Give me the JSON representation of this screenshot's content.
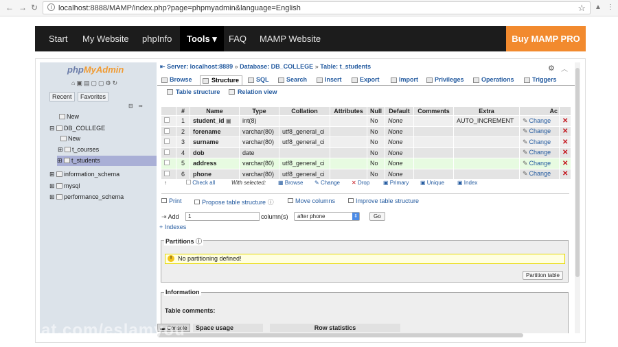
{
  "browser": {
    "url": "localhost:8888/MAMP/index.php?page=phpmyadmin&language=English"
  },
  "mamp_nav": {
    "items": [
      "Start",
      "My Website",
      "phpInfo",
      "Tools ▾",
      "FAQ",
      "MAMP Website"
    ],
    "active": "Tools ▾",
    "buy": "Buy MAMP PRO",
    "accent_color": "#f28a2e"
  },
  "pma": {
    "logo_a": "php",
    "logo_b": "MyAdmin",
    "nav_tabs": [
      "Recent",
      "Favorites"
    ],
    "tree": [
      {
        "label": "New",
        "level": 1
      },
      {
        "label": "DB_COLLEGE",
        "level": 0
      },
      {
        "label": "New",
        "level": 2
      },
      {
        "label": "t_courses",
        "level": 2
      },
      {
        "label": "t_students",
        "level": 2,
        "selected": true
      },
      {
        "label": "information_schema",
        "level": 0
      },
      {
        "label": "mysql",
        "level": 0
      },
      {
        "label": "performance_schema",
        "level": 0
      }
    ]
  },
  "breadcrumb": {
    "server": "Server: localhost:8889",
    "database": "Database: DB_COLLEGE",
    "table": "Table: t_students",
    "sep": "»"
  },
  "tabs": [
    "Browse",
    "Structure",
    "SQL",
    "Search",
    "Insert",
    "Export",
    "Import",
    "Privileges",
    "Operations",
    "Triggers"
  ],
  "active_tab": "Structure",
  "subtabs": [
    "Table structure",
    "Relation view"
  ],
  "columns": {
    "headers": [
      "",
      "#",
      "Name",
      "Type",
      "Collation",
      "Attributes",
      "Null",
      "Default",
      "Comments",
      "Extra",
      "Ac"
    ],
    "rows": [
      {
        "num": "1",
        "name": "student_id",
        "type": "int(8)",
        "collation": "",
        "attributes": "",
        "null": "No",
        "default": "None",
        "comments": "",
        "extra": "AUTO_INCREMENT"
      },
      {
        "num": "2",
        "name": "forename",
        "type": "varchar(80)",
        "collation": "utf8_general_ci",
        "attributes": "",
        "null": "No",
        "default": "None",
        "comments": "",
        "extra": ""
      },
      {
        "num": "3",
        "name": "surname",
        "type": "varchar(80)",
        "collation": "utf8_general_ci",
        "attributes": "",
        "null": "No",
        "default": "None",
        "comments": "",
        "extra": ""
      },
      {
        "num": "4",
        "name": "dob",
        "type": "date",
        "collation": "",
        "attributes": "",
        "null": "No",
        "default": "None",
        "comments": "",
        "extra": ""
      },
      {
        "num": "5",
        "name": "address",
        "type": "varchar(80)",
        "collation": "utf8_general_ci",
        "attributes": "",
        "null": "No",
        "default": "None",
        "comments": "",
        "extra": ""
      },
      {
        "num": "6",
        "name": "phone",
        "type": "varchar(80)",
        "collation": "utf8_general_ci",
        "attributes": "",
        "null": "No",
        "default": "None",
        "comments": "",
        "extra": ""
      }
    ],
    "change_label": "Change"
  },
  "with_selected": {
    "check_all": "Check all",
    "label": "With selected:",
    "actions": [
      "Browse",
      "Change",
      "Drop",
      "Primary",
      "Unique",
      "Index"
    ]
  },
  "table_actions": [
    "Print",
    "Propose table structure",
    "Move columns",
    "Improve table structure"
  ],
  "add_column": {
    "add": "Add",
    "value": "1",
    "columns_label": "column(s)",
    "position": "after phone",
    "go": "Go"
  },
  "indexes": "+ Indexes",
  "partitions": {
    "legend": "Partitions",
    "notice": "No partitioning defined!",
    "button": "Partition table"
  },
  "information": {
    "legend": "Information",
    "table_comments": "Table comments:",
    "space_usage": "Space usage",
    "row_statistics": "Row statistics"
  },
  "console": "Console",
  "watermark": "at.com/eslamyou"
}
